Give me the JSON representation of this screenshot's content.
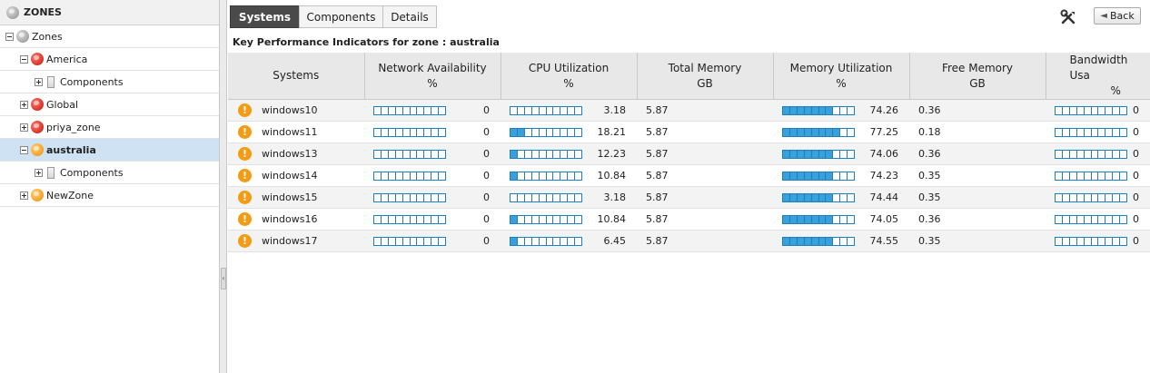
{
  "left_panel": {
    "header": "ZONES",
    "tree": [
      {
        "label": "Zones",
        "level": 0,
        "toggle": "minus",
        "icon": "globe-grey-icon"
      },
      {
        "label": "America",
        "level": 1,
        "toggle": "minus",
        "icon": "globe-red-icon"
      },
      {
        "label": "Components",
        "level": 2,
        "toggle": "plus",
        "icon": "server-icon"
      },
      {
        "label": "Global",
        "level": 1,
        "toggle": "plus",
        "icon": "globe-red-icon"
      },
      {
        "label": "priya_zone",
        "level": 1,
        "toggle": "plus",
        "icon": "globe-red-icon"
      },
      {
        "label": "australia",
        "level": 1,
        "toggle": "minus",
        "icon": "globe-orange-icon",
        "selected": true
      },
      {
        "label": "Components",
        "level": 2,
        "toggle": "plus",
        "icon": "server-icon"
      },
      {
        "label": "NewZone",
        "level": 1,
        "toggle": "plus",
        "icon": "globe-orange-icon"
      }
    ]
  },
  "tabs": [
    {
      "label": "Systems",
      "active": true
    },
    {
      "label": "Components",
      "active": false
    },
    {
      "label": "Details",
      "active": false
    }
  ],
  "toolbar": {
    "back_label": "Back",
    "back_icon": "back-arrow-icon",
    "tools_icon": "tools-icon"
  },
  "kpi_title": "Key Performance Indicators for zone : australia",
  "columns": [
    {
      "label": "Systems",
      "unit": ""
    },
    {
      "label": "Network Availability",
      "unit": "%"
    },
    {
      "label": "CPU Utilization",
      "unit": "%"
    },
    {
      "label": "Total Memory",
      "unit": "GB"
    },
    {
      "label": "Memory Utilization",
      "unit": "%"
    },
    {
      "label": "Free Memory",
      "unit": "GB"
    },
    {
      "label": "Bandwidth Usa",
      "unit": "%"
    }
  ],
  "rows": [
    {
      "name": "windows10",
      "net": "0",
      "cpu": "3.18",
      "total_mem": "5.87",
      "mem_util": "74.26",
      "free_mem": "0.36",
      "bw": "0"
    },
    {
      "name": "windows11",
      "net": "0",
      "cpu": "18.21",
      "total_mem": "5.87",
      "mem_util": "77.25",
      "free_mem": "0.18",
      "bw": "0"
    },
    {
      "name": "windows13",
      "net": "0",
      "cpu": "12.23",
      "total_mem": "5.87",
      "mem_util": "74.06",
      "free_mem": "0.36",
      "bw": "0"
    },
    {
      "name": "windows14",
      "net": "0",
      "cpu": "10.84",
      "total_mem": "5.87",
      "mem_util": "74.23",
      "free_mem": "0.35",
      "bw": "0"
    },
    {
      "name": "windows15",
      "net": "0",
      "cpu": "3.18",
      "total_mem": "5.87",
      "mem_util": "74.44",
      "free_mem": "0.35",
      "bw": "0"
    },
    {
      "name": "windows16",
      "net": "0",
      "cpu": "10.84",
      "total_mem": "5.87",
      "mem_util": "74.05",
      "free_mem": "0.36",
      "bw": "0"
    },
    {
      "name": "windows17",
      "net": "0",
      "cpu": "6.45",
      "total_mem": "5.87",
      "mem_util": "74.55",
      "free_mem": "0.35",
      "bw": "0"
    }
  ],
  "colors": {
    "status_warning": "#f39b12",
    "meter_fill": "#3aa0dc",
    "meter_border": "#1b7fc4",
    "selected_row": "#cfe2f3",
    "active_tab": "#4a4a4a"
  }
}
